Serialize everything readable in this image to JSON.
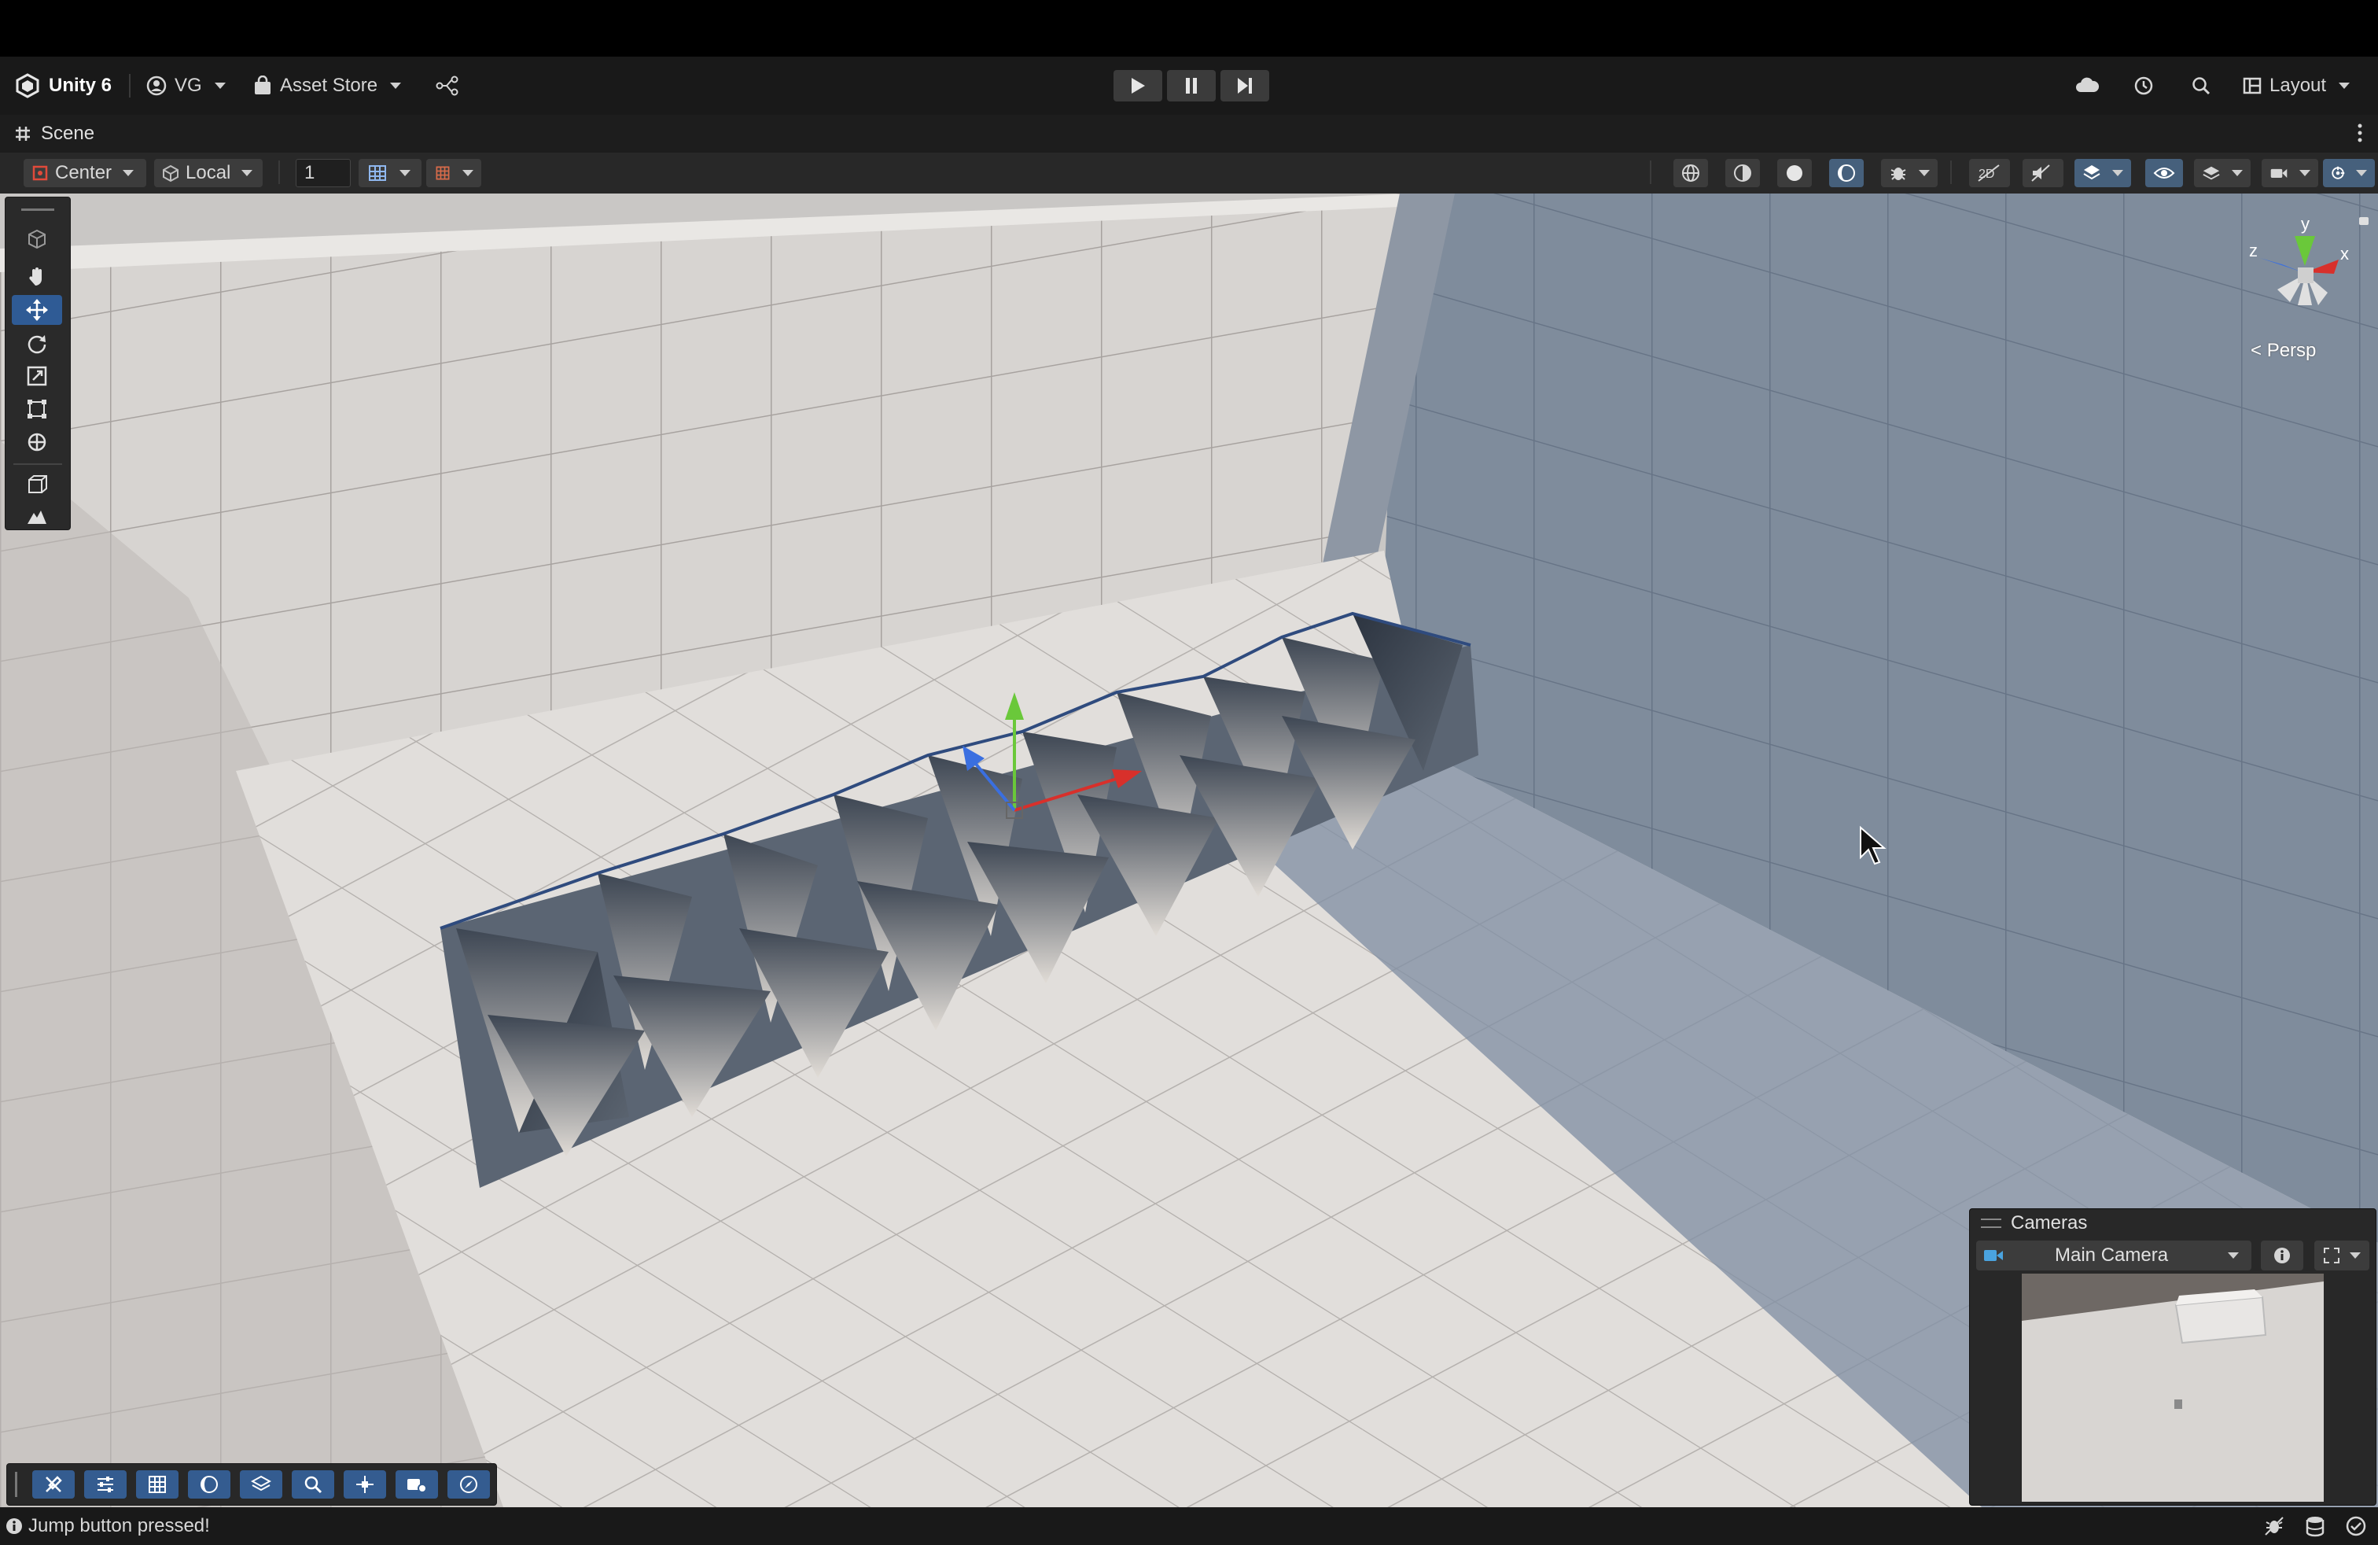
{
  "toolbar": {
    "app_name": "Unity 6",
    "account": "VG",
    "asset_store": "Asset Store",
    "layout": "Layout"
  },
  "scene_tab": {
    "label": "Scene"
  },
  "scene_toolbar": {
    "pivot_mode": "Center",
    "pivot_rotation": "Local",
    "grid_size": "1"
  },
  "viewport": {
    "projection": "Persp",
    "gizmo_axes": {
      "x": "x",
      "y": "y",
      "z": "z"
    }
  },
  "cameras_overlay": {
    "title": "Cameras",
    "selected_camera": "Main Camera"
  },
  "status": {
    "message": "Jump button pressed!"
  },
  "colors": {
    "accent": "#2f5b95",
    "toolbar_bg": "#191919",
    "axis_x": "#d8302b",
    "axis_y": "#6ac83a",
    "axis_z": "#3a6fe0"
  }
}
